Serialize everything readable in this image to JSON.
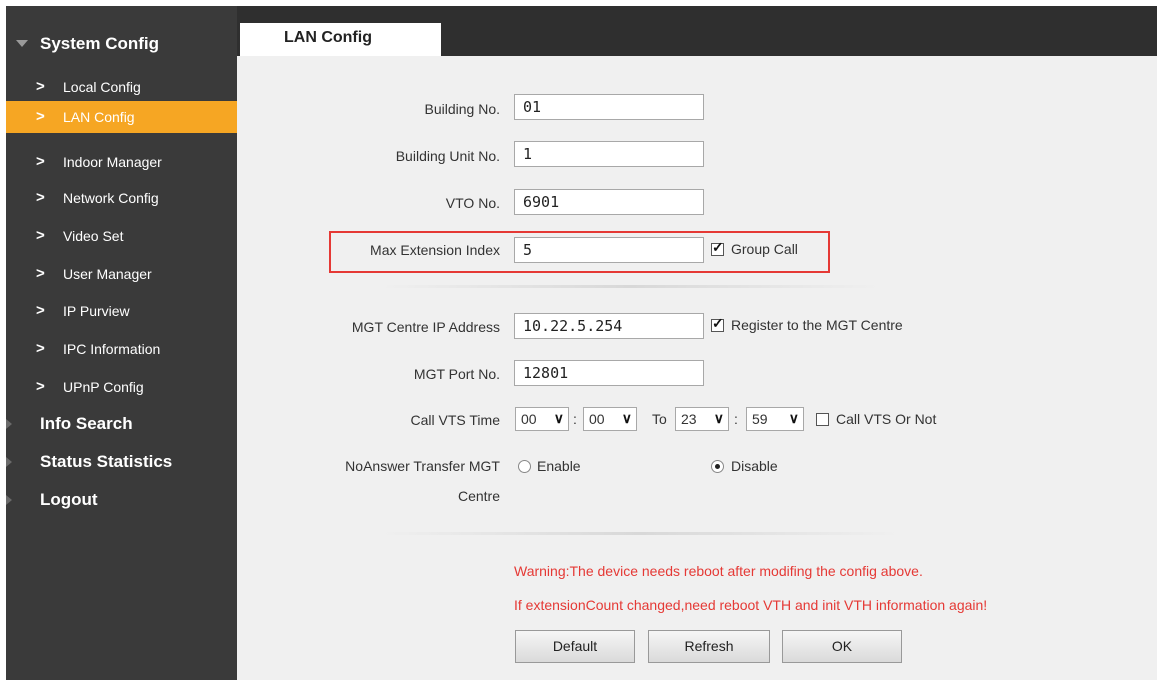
{
  "sidebar": {
    "system_config": "System Config",
    "items": [
      {
        "label": "Local Config"
      },
      {
        "label": "LAN Config"
      },
      {
        "label": "Indoor Manager"
      },
      {
        "label": "Network Config"
      },
      {
        "label": "Video Set"
      },
      {
        "label": "User Manager"
      },
      {
        "label": "IP Purview"
      },
      {
        "label": "IPC Information"
      },
      {
        "label": "UPnP Config"
      }
    ],
    "chevron": ">",
    "info_search": "Info Search",
    "status_statistics": "Status Statistics",
    "logout": "Logout"
  },
  "tab": {
    "label": "LAN Config"
  },
  "form": {
    "building_no": {
      "label": "Building No.",
      "value": "01"
    },
    "building_unit_no": {
      "label": "Building Unit No.",
      "value": "1"
    },
    "vto_no": {
      "label": "VTO No.",
      "value": "6901"
    },
    "max_extension_index": {
      "label": "Max Extension Index",
      "value": "5"
    },
    "group_call": {
      "label": "Group Call",
      "checked": true
    },
    "mgt_ip": {
      "label": "MGT Centre IP Address",
      "value": "10.22.5.254"
    },
    "register_mgt": {
      "label": "Register to the MGT Centre",
      "checked": true
    },
    "mgt_port": {
      "label": "MGT Port No.",
      "value": "12801"
    },
    "call_vts_time": {
      "label": "Call VTS Time",
      "start_hour": "00",
      "start_min": "00",
      "to_label": "To",
      "end_hour": "23",
      "end_min": "59",
      "colon": ":"
    },
    "call_vts_or_not": {
      "label": "Call VTS Or Not",
      "checked": false
    },
    "noanswer": {
      "label_line1": "NoAnswer Transfer MGT",
      "label_line2": "Centre",
      "enable_label": "Enable",
      "disable_label": "Disable",
      "selected": "Disable"
    }
  },
  "warnings": {
    "line1": "Warning:The device needs reboot after modifing the config above.",
    "line2": "If extensionCount changed,need reboot VTH and init VTH information again!"
  },
  "buttons": {
    "default": "Default",
    "refresh": "Refresh",
    "ok": "OK"
  },
  "colors": {
    "active_item": "#f6a623",
    "sidebar_bg": "#3a3a3a",
    "topbar_bg": "#2f2f2f",
    "warning_text": "#e53935",
    "highlight_border": "#e53935"
  },
  "icons": {
    "dropdown": "chevron-down-icon",
    "nav": "chevron-right-icon"
  }
}
